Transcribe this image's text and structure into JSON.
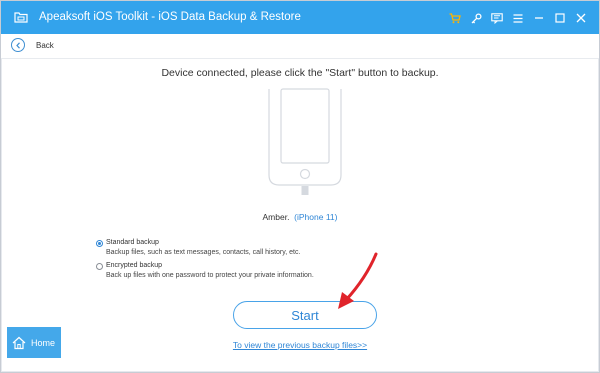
{
  "window": {
    "title": "Apeaksoft iOS Toolkit - iOS Data Backup & Restore",
    "toolbar_icons": [
      "cart-icon",
      "key-icon",
      "feedback-icon",
      "menu-icon",
      "minimize-icon",
      "maximize-icon",
      "close-icon"
    ]
  },
  "nav": {
    "back_label": "Back"
  },
  "main": {
    "headline": "Device connected, please click the \"Start\" button to backup.",
    "device_name": "Amber.",
    "device_model": "(iPhone 11)",
    "options": [
      {
        "title": "Standard backup",
        "description": "Backup files, such as text messages, contacts, call history, etc.",
        "selected": true
      },
      {
        "title": "Encrypted backup",
        "description": "Back up files with one password to protect your private information.",
        "selected": false
      }
    ],
    "start_label": "Start",
    "previous_link": "To view the previous backup files>>"
  },
  "home": {
    "label": "Home"
  },
  "colors": {
    "titlebar": "#33a3ec",
    "accent": "#2f86d6",
    "home_bg": "#44a8ea",
    "annotation_arrow": "#e0242b"
  }
}
